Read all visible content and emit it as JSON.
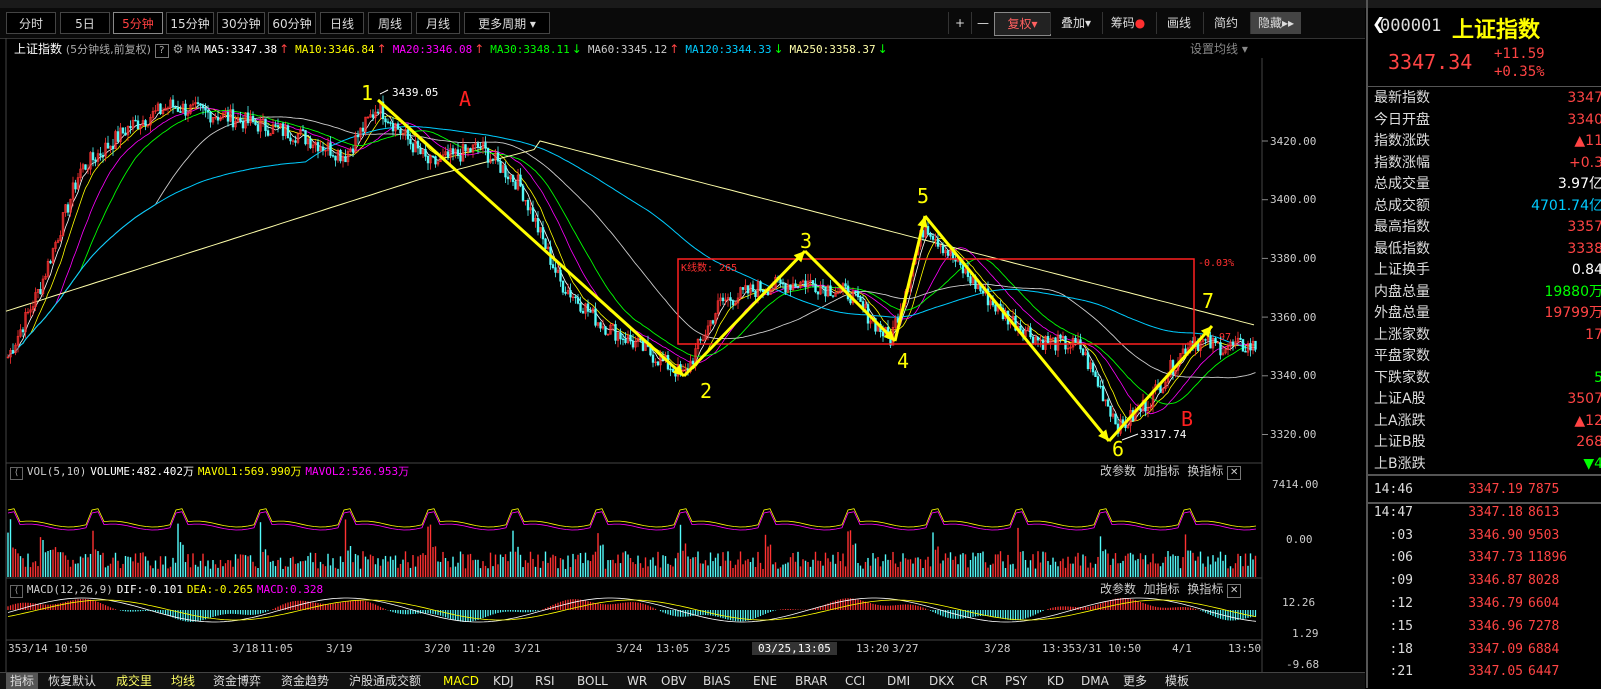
{
  "toolbar": {
    "periods": [
      "分时",
      "5日",
      "5分钟",
      "15分钟",
      "30分钟",
      "60分钟",
      "日线",
      "周线",
      "月线",
      "更多周期"
    ],
    "active_period": "5分钟",
    "right_buttons": [
      "+",
      "—",
      "复权",
      "叠加",
      "筹码",
      "画线",
      "简约",
      "隐藏"
    ]
  },
  "chart": {
    "title": "上证指数",
    "subtitle": "(5分钟线,前复权)",
    "ma_label": "MA",
    "ma_items": [
      {
        "label": "MA5:3347.38",
        "arrow": "↑",
        "color": "#ffffff"
      },
      {
        "label": "MA10:3346.84",
        "arrow": "↑",
        "color": "#ffff00"
      },
      {
        "label": "MA20:3346.08",
        "arrow": "↑",
        "color": "#ff00ff"
      },
      {
        "label": "MA30:3348.11",
        "arrow": "↓",
        "color": "#00ff00"
      },
      {
        "label": "MA60:3345.12",
        "arrow": "↑",
        "color": "#cccccc"
      },
      {
        "label": "MA120:3344.33",
        "arrow": "↓",
        "color": "#00ccff"
      },
      {
        "label": "MA250:3358.37",
        "arrow": "↓",
        "color": "#ffffaa"
      }
    ],
    "settings_label": "设置均线",
    "price_axis": [
      "3420.00",
      "3400.00",
      "3380.00",
      "3360.00",
      "3340.00",
      "3320.00"
    ],
    "annotations": {
      "high": "3439.05",
      "low": "3317.74",
      "box_label": "K线数: 265",
      "box_pct": "-0.03%",
      "right_val": "97",
      "wave_points": [
        "1",
        "2",
        "3",
        "4",
        "5",
        "6",
        "7"
      ],
      "letter_a": "A",
      "letter_b": "B"
    }
  },
  "volume": {
    "label": "VOL(5,10)",
    "volume": "VOLUME:482.402万",
    "mavol1": "MAVOL1:569.990万",
    "mavol2": "MAVOL2:526.953万",
    "axis_top": "7414.00",
    "axis_bottom": "0.00",
    "actions": [
      "改参数",
      "加指标",
      "换指标"
    ]
  },
  "macd": {
    "label": "MACD(12,26,9)",
    "dif": "DIF:-0.101",
    "dea": "DEA:-0.265",
    "macd": "MACD:0.328",
    "axis": [
      "12.26",
      "1.29",
      "-9.68"
    ],
    "actions": [
      "改参数",
      "加指标",
      "换指标"
    ]
  },
  "time_axis": [
    "353/14 10:50",
    "3/18",
    "11:05",
    "3/19",
    "3/20",
    "11:20",
    "3/21",
    "3/24",
    "13:05",
    "3/25",
    "03/25,13:05",
    "13:20",
    "3/27",
    "3/28",
    "13:353/31",
    "10:50",
    "4/1",
    "13:50"
  ],
  "bottom_tabs": [
    "指标",
    "恢复默认",
    "成交里",
    "均线",
    "资金博弈",
    "资金趋势",
    "沪股通成交额",
    "MACD",
    "KDJ",
    "RSI",
    "BOLL",
    "WR",
    "OBV",
    "BIAS",
    "ENE",
    "BRAR",
    "CCI",
    "DMI",
    "DKX",
    "CR",
    "PSY",
    "KD",
    "DMA",
    "更多",
    "模板"
  ],
  "panel": {
    "code": "000001",
    "name": "上证指数",
    "price": "3347.34",
    "change": "+11.59",
    "change_pct": "+0.35%",
    "stats": [
      {
        "k": "最新指数",
        "v": "3347",
        "c": "#ff4444"
      },
      {
        "k": "今日开盘",
        "v": "3340",
        "c": "#ff4444"
      },
      {
        "k": "指数涨跌",
        "v": "▲11",
        "c": "#ff4444"
      },
      {
        "k": "指数涨幅",
        "v": "+0.3",
        "c": "#ff4444"
      },
      {
        "k": "总成交量",
        "v": "3.97亿",
        "c": "#ffffff"
      },
      {
        "k": "总成交额",
        "v": "4701.74亿",
        "c": "#00ccff"
      },
      {
        "k": "最高指数",
        "v": "3357",
        "c": "#ff4444"
      },
      {
        "k": "最低指数",
        "v": "3338",
        "c": "#ff4444"
      },
      {
        "k": "上证换手",
        "v": "0.84",
        "c": "#ffffff"
      },
      {
        "k": "内盘总量",
        "v": "19880万",
        "c": "#00ff00"
      },
      {
        "k": "外盘总量",
        "v": "19799万",
        "c": "#ff4444"
      },
      {
        "k": "上涨家数",
        "v": "17",
        "c": "#ff4444"
      },
      {
        "k": "平盘家数",
        "v": "",
        "c": "#ffffff"
      },
      {
        "k": "下跌家数",
        "v": "5",
        "c": "#00ff00"
      },
      {
        "k": "上证A股",
        "v": "3507",
        "c": "#ff4444"
      },
      {
        "k": "上A涨跌",
        "v": "▲12",
        "c": "#ff4444"
      },
      {
        "k": "上证B股",
        "v": "268",
        "c": "#ff4444"
      },
      {
        "k": "上B涨跌",
        "v": "▼4",
        "c": "#00ff00"
      }
    ],
    "ticks": [
      {
        "t": "14:46",
        "p": "3347.19",
        "v": "7875"
      },
      {
        "t": "14:47",
        "p": "3347.18",
        "v": "8613"
      },
      {
        "t": ":03",
        "p": "3346.90",
        "v": "9503"
      },
      {
        "t": ":06",
        "p": "3347.73",
        "v": "11896"
      },
      {
        "t": ":09",
        "p": "3346.87",
        "v": "8028"
      },
      {
        "t": ":12",
        "p": "3346.79",
        "v": "6604"
      },
      {
        "t": ":15",
        "p": "3346.96",
        "v": "7278"
      },
      {
        "t": ":18",
        "p": "3347.09",
        "v": "6884"
      },
      {
        "t": ":21",
        "p": "3347.05",
        "v": "6447"
      }
    ]
  }
}
